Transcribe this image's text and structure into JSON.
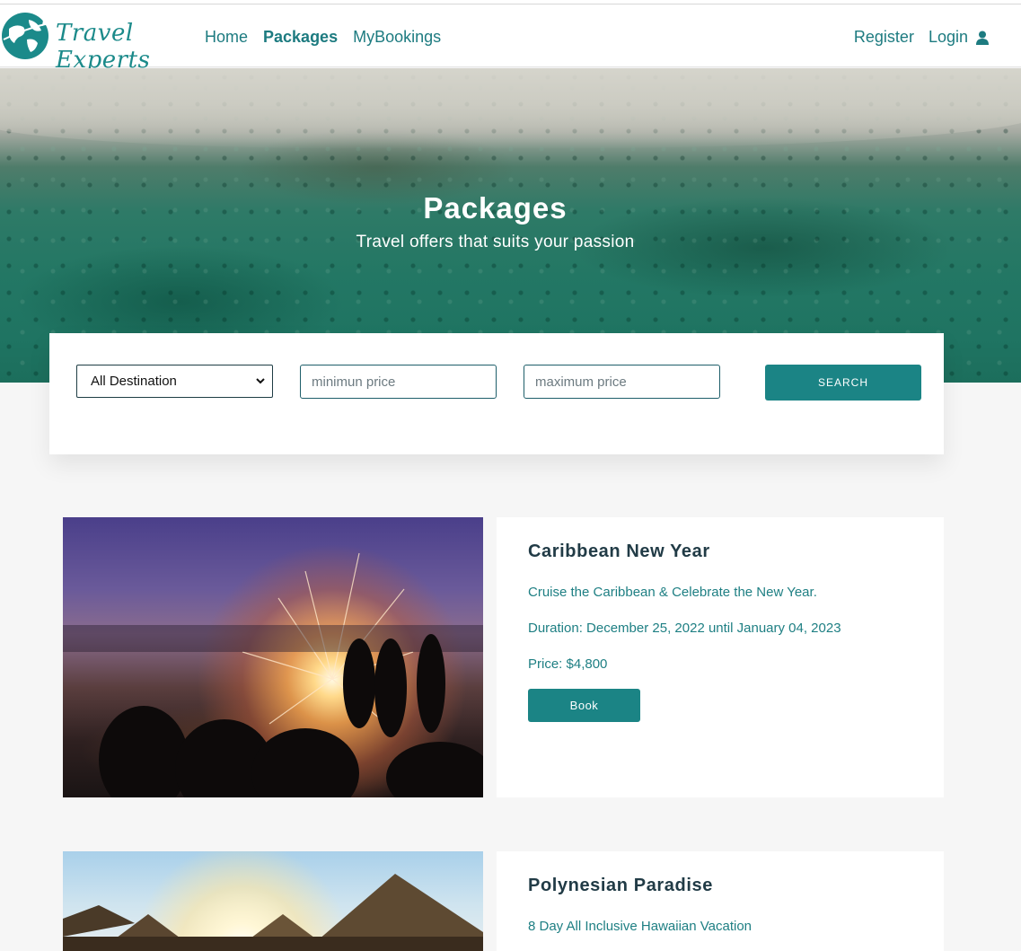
{
  "brand": {
    "name": "Travel Experts"
  },
  "nav": {
    "links": [
      {
        "label": "Home"
      },
      {
        "label": "Packages"
      },
      {
        "label": "MyBookings"
      }
    ],
    "register_label": "Register",
    "login_label": "Login"
  },
  "hero": {
    "title": "Packages",
    "subtitle": "Travel offers that suits your passion"
  },
  "search": {
    "destination_selected": "All Destination",
    "min_placeholder": "minimun price",
    "max_placeholder": "maximum price",
    "button_label": "SEARCH"
  },
  "packages": [
    {
      "title": "Caribbean New Year",
      "description": "Cruise the Caribbean & Celebrate the New Year.",
      "duration": "Duration: December 25, 2022 until January 04, 2023",
      "price": "Price: $4,800",
      "book_label": "Book"
    },
    {
      "title": "Polynesian Paradise",
      "description": "8 Day All Inclusive Hawaiian Vacation"
    }
  ],
  "colors": {
    "accent": "#1b8485",
    "text_teal": "#1e7f83",
    "heading_dark": "#213b46",
    "page_bg": "#f6f6f6"
  },
  "icons": {
    "logo": "globe-icon",
    "login": "user-icon",
    "select": "chevron-down-icon"
  }
}
